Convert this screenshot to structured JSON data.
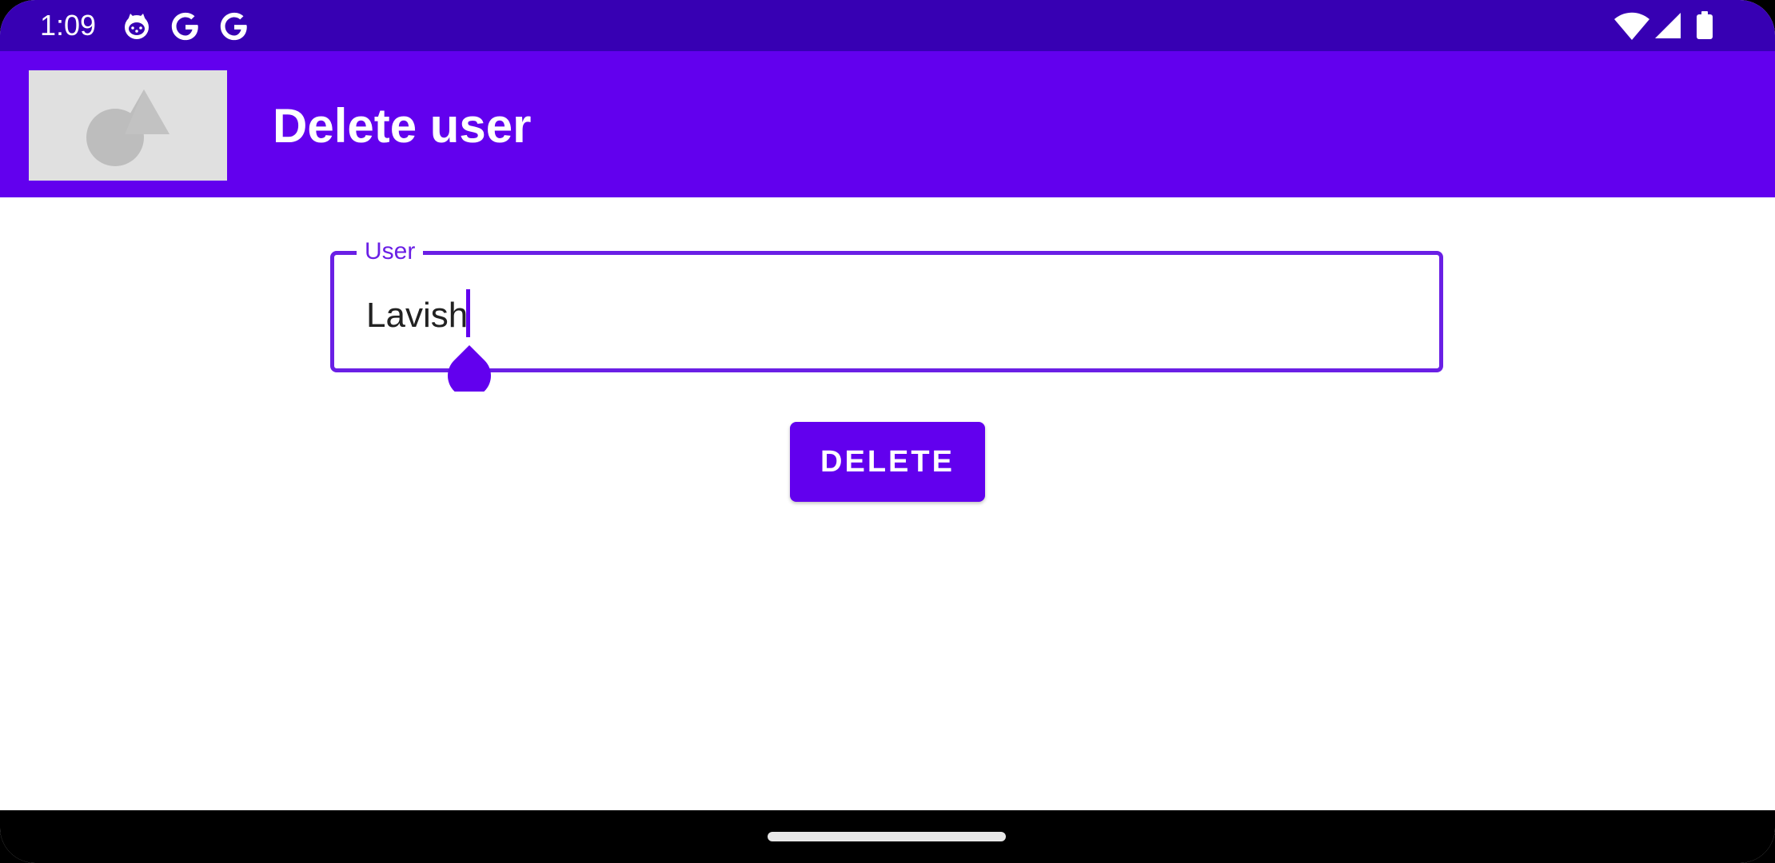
{
  "status_bar": {
    "time": "1:09",
    "left_icons": [
      "cat-notification-icon",
      "google-icon",
      "google-icon"
    ],
    "right_icons": [
      "wifi-icon",
      "signal-icon",
      "battery-icon"
    ],
    "background": "#3700b3"
  },
  "app_bar": {
    "title": "Delete user",
    "logo_icon": "image-placeholder-icon",
    "background": "#6200ee"
  },
  "form": {
    "user_field": {
      "label": "User",
      "value": "Lavish"
    },
    "delete_button_label": "DELETE"
  },
  "colors": {
    "primary": "#6200ee",
    "primary_dark": "#3700b3",
    "field_outline": "#6a1fe5"
  }
}
